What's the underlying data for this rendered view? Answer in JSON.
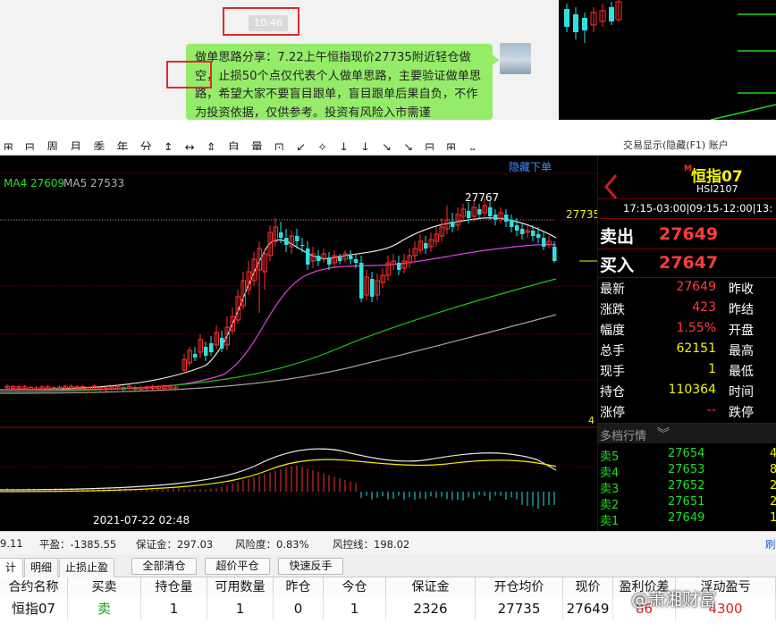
{
  "chat": {
    "time": "10:46",
    "message": "做单思路分享：7.22上午恒指现价27735附近轻仓做空，止损50个点仅代表个人做单思路，主要验证做单思路，希望大家不要盲目跟单，盲目跟单后果自负，不作为投资依据，仅供参考。投资有风险入市需谨"
  },
  "toolbar": {
    "icons_text": "⊞ ⊟ 周 月 季 年 分 ↕ ↔ ⇕ 自 量 ⊡ ↙ ✧ ↓ ↓ ↘ ↘ ⊟ ⊞ ⌄",
    "right_text": "交易显示(隐藏(F1)   账户"
  },
  "chart": {
    "hide_orders": "隐藏下单",
    "ma4_label": "MA4 27609",
    "ma5_label": "MA5 27533",
    "high_label": "27767",
    "price_label": "27735",
    "vol_num": "4",
    "date_label": "2021-07-22 02:48"
  },
  "chart_data": {
    "type": "candlestick",
    "series": [
      {
        "name": "MA4 27609"
      },
      {
        "name": "MA5 27533"
      }
    ],
    "annotations": [
      "27767",
      "27735"
    ]
  },
  "quote": {
    "name": "恒指07",
    "code": "HSI2107",
    "sessions": "17:15-03:00|09:15-12:00|13:",
    "sell_label": "卖出",
    "sell_price": "27649",
    "buy_label": "买入",
    "buy_price": "27647",
    "rows": [
      {
        "l1": "最新",
        "v1": "27649",
        "l2": "昨收"
      },
      {
        "l1": "涨跌",
        "v1": "423",
        "l2": "昨结"
      },
      {
        "l1": "幅度",
        "v1": "1.55%",
        "l2": "开盘"
      },
      {
        "l1": "总手",
        "v1": "62151",
        "l2": "最高"
      },
      {
        "l1": "现手",
        "v1": "1",
        "l2": "最低"
      },
      {
        "l1": "持仓",
        "v1": "110364",
        "l2": "时间"
      },
      {
        "l1": "涨停",
        "v1": "--",
        "l2": "跌停"
      }
    ],
    "depth_title": "多档行情",
    "depth": [
      {
        "label": "卖5",
        "price": "27654",
        "qty": "4"
      },
      {
        "label": "卖4",
        "price": "27653",
        "qty": "8"
      },
      {
        "label": "卖3",
        "price": "27652",
        "qty": "2"
      },
      {
        "label": "卖2",
        "price": "27651",
        "qty": "2"
      },
      {
        "label": "卖1",
        "price": "27649",
        "qty": "1"
      }
    ]
  },
  "account": {
    "a0": "9.11",
    "a1": "平盈：-1385.55",
    "a2": "保证金：297.03",
    "a3": "风险度：0.83%",
    "a4": "风控线：198.02",
    "a5": "刷"
  },
  "tabs": {
    "t0": "计",
    "t1": "明细",
    "t2": "止损止盈",
    "b0": "全部清仓",
    "b1": "超价平仓",
    "b2": "快速反手"
  },
  "table": {
    "headers": [
      "合约名称",
      "买卖",
      "持仓量",
      "可用数量",
      "昨仓",
      "今仓",
      "保证金",
      "开仓均价",
      "现价",
      "盈利价差",
      "浮动盈亏"
    ],
    "row": [
      "恒指07",
      "卖",
      "1",
      "1",
      "0",
      "1",
      "2326",
      "27735",
      "27649",
      "86",
      "4300"
    ]
  },
  "watermark": "@萧湘财富"
}
